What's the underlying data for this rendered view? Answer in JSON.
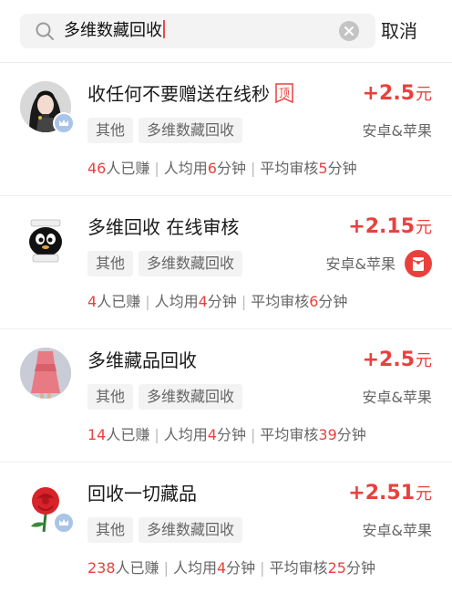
{
  "search": {
    "query": "多维数藏回收",
    "cancel_label": "取消"
  },
  "colors": {
    "accent_red": "#e8413d",
    "tag_bg": "#f3f3f3",
    "badge_blue": "#a9c4e6"
  },
  "tasks": [
    {
      "title": "收任何不要赠送在线秒",
      "pinned": true,
      "pinned_label": "顶",
      "price": "+2.5",
      "price_unit": "元",
      "tags": [
        "其他",
        "多维数藏回收"
      ],
      "platform": "安卓&苹果",
      "earned_count": "46",
      "earned_suffix": "人已赚",
      "avg_prefix": "人均用",
      "avg_minutes": "6",
      "avg_suffix": "分钟",
      "review_prefix": "平均审核",
      "review_minutes": "5",
      "review_suffix": "分钟",
      "avatar_icon": "avatar-girl-icon",
      "verified_badge": true
    },
    {
      "title": "多维回收 在线审核",
      "pinned": false,
      "price": "+2.15",
      "price_unit": "元",
      "tags": [
        "其他",
        "多维数藏回收"
      ],
      "platform": "安卓&苹果",
      "red_packet": true,
      "earned_count": "4",
      "earned_suffix": "人已赚",
      "avg_prefix": "人均用",
      "avg_minutes": "4",
      "avg_suffix": "分钟",
      "review_prefix": "平均审核",
      "review_minutes": "6",
      "review_suffix": "分钟",
      "avatar_icon": "avatar-penguin-icon",
      "verified_badge": false
    },
    {
      "title": "多维藏品回收",
      "pinned": false,
      "price": "+2.5",
      "price_unit": "元",
      "tags": [
        "其他",
        "多维数藏回收"
      ],
      "platform": "安卓&苹果",
      "earned_count": "14",
      "earned_suffix": "人已赚",
      "avg_prefix": "人均用",
      "avg_minutes": "4",
      "avg_suffix": "分钟",
      "review_prefix": "平均审核",
      "review_minutes": "39",
      "review_suffix": "分钟",
      "avatar_icon": "avatar-dress-icon",
      "verified_badge": false
    },
    {
      "title": "回收一切藏品",
      "pinned": false,
      "price": "+2.51",
      "price_unit": "元",
      "tags": [
        "其他",
        "多维数藏回收"
      ],
      "platform": "安卓&苹果",
      "earned_count": "238",
      "earned_suffix": "人已赚",
      "avg_prefix": "人均用",
      "avg_minutes": "4",
      "avg_suffix": "分钟",
      "review_prefix": "平均审核",
      "review_minutes": "25",
      "review_suffix": "分钟",
      "avatar_icon": "avatar-rose-icon",
      "verified_badge": true
    }
  ]
}
